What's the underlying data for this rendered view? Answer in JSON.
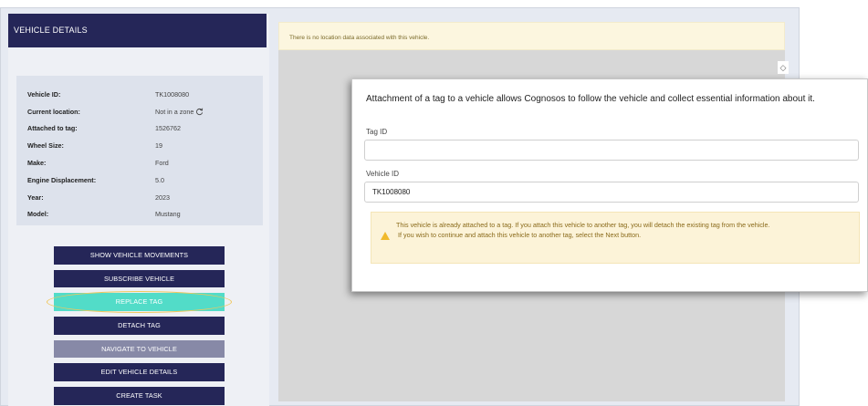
{
  "header": {
    "title": "VEHICLE DETAILS"
  },
  "details": [
    {
      "label": "Vehicle ID:",
      "value": "TK1008080"
    },
    {
      "label": "Current location:",
      "value": "Not in a zone"
    },
    {
      "label": "Attached to tag:",
      "value": "1526762"
    },
    {
      "label": "Wheel Size:",
      "value": "19"
    },
    {
      "label": "Make:",
      "value": "Ford"
    },
    {
      "label": "Engine Displacement:",
      "value": "5.0"
    },
    {
      "label": "Year:",
      "value": "2023"
    },
    {
      "label": "Model:",
      "value": "Mustang"
    }
  ],
  "buttons": {
    "show_movements": "SHOW VEHICLE MOVEMENTS",
    "subscribe": "SUBSCRIBE VEHICLE",
    "replace_tag": "REPLACE TAG",
    "detach_tag": "DETACH TAG",
    "navigate": "NAVIGATE TO VEHICLE",
    "edit": "EDIT VEHICLE DETAILS",
    "create_task": "CREATE TASK"
  },
  "notice": "There is no location data associated with this vehicle.",
  "modal": {
    "intro": "Attachment of a tag to a vehicle allows Cognosos to follow the vehicle and collect essential information about it.",
    "tag_label": "Tag ID",
    "tag_value": "",
    "vehicle_label": "Vehicle ID",
    "vehicle_value": "TK1008080",
    "warning_line1": "This vehicle is already attached to a tag. If you attach this vehicle to another tag, you will detach the existing tag from the vehicle.",
    "warning_line2": "If you wish to continue and attach this vehicle to another tag, select the Next button."
  },
  "icons": {
    "refresh": "refresh-icon",
    "collapse": "collapse-arrow-icon",
    "warning": "warning-icon"
  },
  "colors": {
    "navy": "#252658",
    "accent": "#52dcc8",
    "disabled": "#8789a7",
    "highlight_ring": "#f0c75c"
  }
}
